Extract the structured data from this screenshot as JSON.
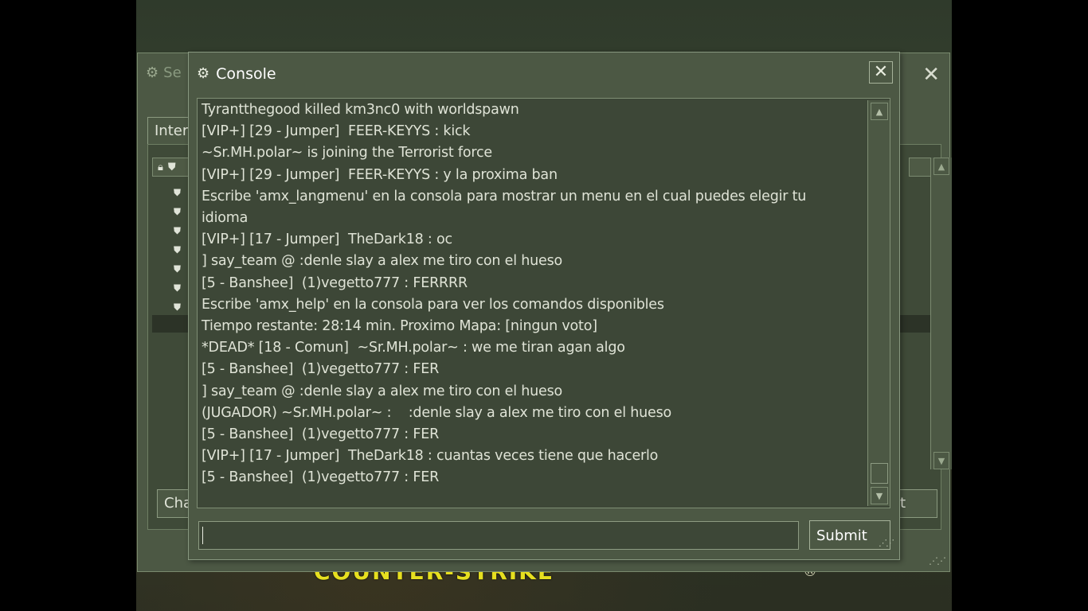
{
  "background": {
    "logo_text": "COUNTER-STRIKE",
    "logo_mark": "®"
  },
  "server_browser": {
    "title": "Se",
    "tab_label": "Inter",
    "left_button": "Cha",
    "right_button": "t"
  },
  "console": {
    "title": "Console",
    "log_lines": [
      "Tyrantthegood killed km3nc0 with worldspawn",
      "[VIP+] [29 - Jumper]  FEER-KEYYS : kick",
      "~Sr.MH.polar~ is joining the Terrorist force",
      "[VIP+] [29 - Jumper]  FEER-KEYYS : y la proxima ban",
      "Escribe 'amx_langmenu' en la consola para mostrar un menu en el cual puedes elegir tu",
      "idioma",
      "[VIP+] [17 - Jumper]  TheDark18 : oc",
      "] say_team @ :denle slay a alex me tiro con el hueso",
      "[5 - Banshee]  (1)vegetto777 : FERRRR",
      "Escribe 'amx_help' en la consola para ver los comandos disponibles",
      "Tiempo restante: 28:14 min. Proximo Mapa: [ningun voto]",
      "*DEAD* [18 - Comun]  ~Sr.MH.polar~ : we me tiran agan algo",
      "[5 - Banshee]  (1)vegetto777 : FER",
      "] say_team @ :denle slay a alex me tiro con el hueso",
      "(JUGADOR) ~Sr.MH.polar~ :    :denle slay a alex me tiro con el hueso",
      "[5 - Banshee]  (1)vegetto777 : FER",
      "[VIP+] [17 - Jumper]  TheDark18 : cuantas veces tiene que hacerlo",
      "[5 - Banshee]  (1)vegetto777 : FER"
    ],
    "input_value": "",
    "submit_label": "Submit",
    "icons": {
      "title": "steam-icon",
      "close": "close-icon",
      "scroll_up": "scroll-up-icon",
      "scroll_down": "scroll-down-icon",
      "resize": "resize-grip-icon"
    }
  }
}
